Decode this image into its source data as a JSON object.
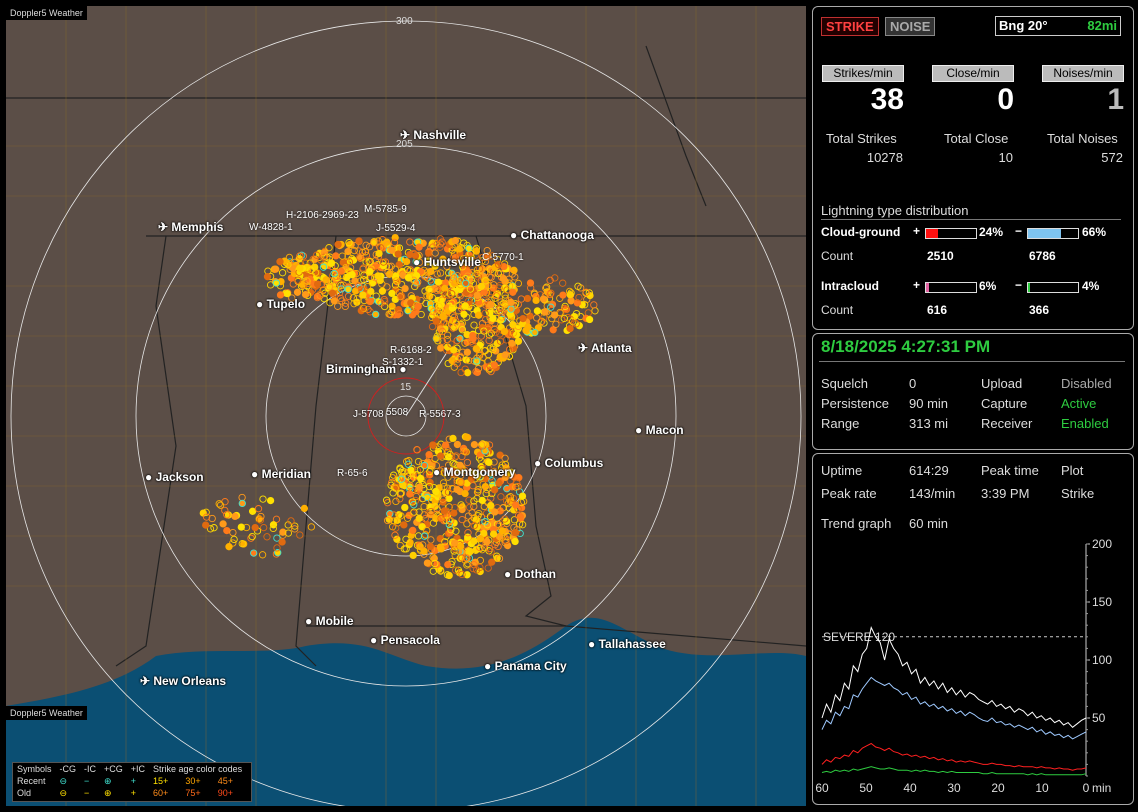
{
  "app": {
    "brand": "Doppler5 Weather"
  },
  "map": {
    "rings": [
      {
        "label": "300"
      },
      {
        "label": "205"
      },
      {
        "label": "15"
      }
    ],
    "cities": [
      {
        "name": "Nashville",
        "icon": "airport-icon"
      },
      {
        "name": "Memphis",
        "icon": "airport-icon"
      },
      {
        "name": "Chattanooga",
        "icon": "city-dot-icon"
      },
      {
        "name": "Huntsville",
        "icon": "city-dot-icon"
      },
      {
        "name": "Tupelo",
        "icon": "city-dot-icon"
      },
      {
        "name": "Atlanta",
        "icon": "airport-icon"
      },
      {
        "name": "Birmingham",
        "icon": "city-dot-icon"
      },
      {
        "name": "Macon",
        "icon": "city-dot-icon"
      },
      {
        "name": "Jackson",
        "icon": "city-dot-icon"
      },
      {
        "name": "Meridian",
        "icon": "city-dot-icon"
      },
      {
        "name": "Montgomery",
        "icon": "city-dot-icon"
      },
      {
        "name": "Columbus",
        "icon": "city-dot-icon"
      },
      {
        "name": "Dothan",
        "icon": "city-dot-icon"
      },
      {
        "name": "Mobile",
        "icon": "city-dot-icon"
      },
      {
        "name": "Pensacola",
        "icon": "city-dot-icon"
      },
      {
        "name": "Tallahassee",
        "icon": "city-dot-icon"
      },
      {
        "name": "Panama City",
        "icon": "city-dot-icon"
      },
      {
        "name": "New Orleans",
        "icon": "airport-icon"
      }
    ],
    "stations": [
      "M-5785-9",
      "H-2106-2969-23",
      "W-4828-1",
      "J-5529-4",
      "C-5770-1",
      "R-6168-2",
      "S-1332-1",
      "J-5708",
      "5508",
      "R-5567-3",
      "R-65-6"
    ]
  },
  "legend": {
    "header": [
      "Symbols",
      "-CG",
      "-IC",
      "+CG",
      "+IC",
      "Strike age color codes"
    ],
    "recent": {
      "label": "Recent",
      "ages": [
        "15+",
        "30+",
        "45+"
      ]
    },
    "old": {
      "label": "Old",
      "ages": [
        "60+",
        "75+",
        "90+"
      ]
    }
  },
  "status": {
    "strike_label": "STRIKE",
    "noise_label": "NOISE",
    "bearing": "Bng 20°",
    "distance": "82mi"
  },
  "rates": {
    "strikes_label": "Strikes/min",
    "strikes_value": "38",
    "close_label": "Close/min",
    "close_value": "0",
    "noises_label": "Noises/min",
    "noises_value": "1"
  },
  "totals": {
    "strikes_label": "Total Strikes",
    "strikes_value": "10278",
    "close_label": "Total Close",
    "close_value": "10",
    "noises_label": "Total Noises",
    "noises_value": "572"
  },
  "distribution": {
    "title": "Lightning type distribution",
    "cg_label": "Cloud-ground",
    "cg_pos_pct": "24%",
    "cg_pos_fraction": 0.24,
    "cg_neg_pct": "66%",
    "cg_neg_fraction": 0.66,
    "count_label": "Count",
    "cg_pos_count": "2510",
    "cg_neg_count": "6786",
    "ic_label": "Intracloud",
    "ic_pos_pct": "6%",
    "ic_pos_fraction": 0.06,
    "ic_neg_pct": "4%",
    "ic_neg_fraction": 0.04,
    "ic_pos_count": "616",
    "ic_neg_count": "366",
    "plus": "+",
    "minus": "−"
  },
  "datetime": "8/18/2025 4:27:31 PM",
  "settings": {
    "squelch_label": "Squelch",
    "squelch_value": "0",
    "persistence_label": "Persistence",
    "persistence_value": "90 min",
    "range_label": "Range",
    "range_value": "313 mi",
    "upload_label": "Upload",
    "upload_value": "Disabled",
    "capture_label": "Capture",
    "capture_value": "Active",
    "receiver_label": "Receiver",
    "receiver_value": "Enabled"
  },
  "stats": {
    "uptime_label": "Uptime",
    "uptime_value": "614:29",
    "peak_time_label": "Peak time",
    "plot_label": "Plot",
    "peak_rate_label": "Peak rate",
    "peak_rate_value": "143/min",
    "peak_time_value": "3:39 PM",
    "plot_value": "Strike",
    "trend_label": "Trend graph",
    "trend_value": "60 min"
  },
  "chart_data": {
    "type": "line",
    "x_unit": "min",
    "xticks": [
      "60",
      "50",
      "40",
      "30",
      "20",
      "10",
      "0"
    ],
    "yticks": [
      "200",
      "150",
      "100",
      "50"
    ],
    "ylim": [
      0,
      200
    ],
    "xlim": [
      60,
      0
    ],
    "threshold": {
      "label": "SEVERE 120",
      "value": 120
    },
    "series": [
      {
        "color": "#ffffff",
        "values": [
          50,
          62,
          55,
          70,
          65,
          80,
          75,
          95,
          90,
          105,
          110,
          128,
          120,
          115,
          100,
          118,
          110,
          105,
          95,
          98,
          88,
          92,
          80,
          85,
          78,
          82,
          75,
          80,
          72,
          76,
          70,
          74,
          68,
          72,
          70,
          66,
          64,
          62,
          65,
          60,
          62,
          58,
          60,
          55,
          58,
          56,
          52,
          55,
          50,
          52,
          48,
          50,
          46,
          48,
          44,
          46,
          42,
          45,
          48,
          50
        ]
      },
      {
        "color": "#9ec9ff",
        "values": [
          40,
          48,
          45,
          55,
          52,
          60,
          58,
          70,
          68,
          75,
          80,
          85,
          82,
          80,
          78,
          80,
          76,
          74,
          70,
          72,
          66,
          68,
          62,
          64,
          60,
          62,
          58,
          60,
          56,
          58,
          54,
          56,
          52,
          55,
          53,
          50,
          48,
          47,
          50,
          46,
          47,
          44,
          45,
          42,
          44,
          42,
          40,
          42,
          38,
          40,
          36,
          38,
          35,
          36,
          33,
          35,
          32,
          34,
          36,
          38
        ]
      },
      {
        "color": "#ff2020",
        "values": [
          10,
          14,
          12,
          16,
          15,
          18,
          17,
          22,
          20,
          24,
          26,
          28,
          25,
          24,
          22,
          24,
          21,
          20,
          18,
          19,
          17,
          18,
          16,
          17,
          15,
          16,
          14,
          15,
          13,
          14,
          12,
          13,
          12,
          13,
          12,
          11,
          10,
          10,
          11,
          10,
          10,
          9,
          9,
          8,
          9,
          8,
          8,
          8,
          7,
          8,
          7,
          7,
          6,
          7,
          6,
          6,
          5,
          6,
          6,
          7
        ]
      },
      {
        "color": "#2ecc40",
        "values": [
          3,
          4,
          3,
          5,
          4,
          5,
          4,
          6,
          5,
          6,
          7,
          8,
          7,
          6,
          6,
          7,
          6,
          5,
          5,
          5,
          4,
          5,
          4,
          5,
          4,
          4,
          3,
          4,
          3,
          4,
          3,
          3,
          3,
          3,
          3,
          3,
          2,
          2,
          3,
          2,
          2,
          2,
          2,
          2,
          2,
          2,
          1,
          2,
          1,
          2,
          1,
          1,
          1,
          1,
          1,
          1,
          1,
          1,
          1,
          2
        ]
      }
    ]
  }
}
